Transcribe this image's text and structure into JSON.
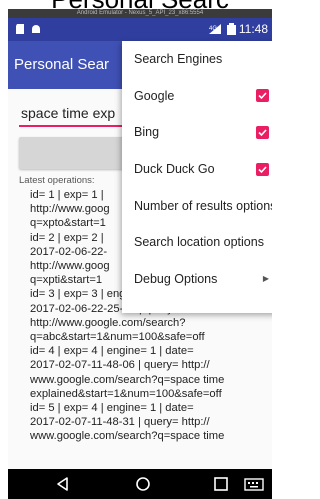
{
  "page": {
    "title": "Personal Searc"
  },
  "emulator": {
    "title": "Android Emulator - Nexus_5_API_23_x86:5554"
  },
  "statusbar": {
    "time": "11:48"
  },
  "app": {
    "title": "Personal Sear",
    "search": {
      "value": "space time exp",
      "placeholder": ""
    },
    "search_button_label": "",
    "ops_label": "Latest operations:",
    "operations_log": "id= 1 | exp= 1 | \nhttp://www.goog\nq=xpto&start=1\nid= 2 | exp= 2 | \n2017-02-06-22-\nhttp://www.goog\nq=xpti&start=1\nid= 3 | exp= 3 | engine= 1 | date=\n2017-02-06-22-25-55 | query=\nhttp://www.google.com/search?\nq=abc&start=1&num=100&safe=off\nid= 4 | exp= 4 | engine= 1 | date=\n2017-02-07-11-48-06 | query= http://\nwww.google.com/search?q=space time\nexplained&start=1&num=100&safe=off\nid= 5 | exp= 4 | engine= 1 | date=\n2017-02-07-11-48-31 | query= http://\nwww.google.com/search?q=space time"
  },
  "menu": {
    "items": [
      {
        "label": "Search Engines"
      },
      {
        "label": "Google",
        "checked": true
      },
      {
        "label": "Bing",
        "checked": true
      },
      {
        "label": "Duck Duck Go",
        "checked": true
      },
      {
        "label": "Number of results options"
      },
      {
        "label": "Search location options"
      },
      {
        "label": "Debug Options",
        "has_submenu": true
      }
    ]
  },
  "icons": {
    "status_left": [
      "sd-card-icon",
      "android-icon"
    ],
    "status_right": [
      "signal-icon",
      "battery-icon"
    ],
    "nav": [
      "back-icon",
      "home-icon",
      "recents-icon",
      "keyboard-icon"
    ]
  },
  "colors": {
    "statusbar": "#303f9f",
    "appbar": "#3f51b5",
    "accent": "#e91e63"
  }
}
